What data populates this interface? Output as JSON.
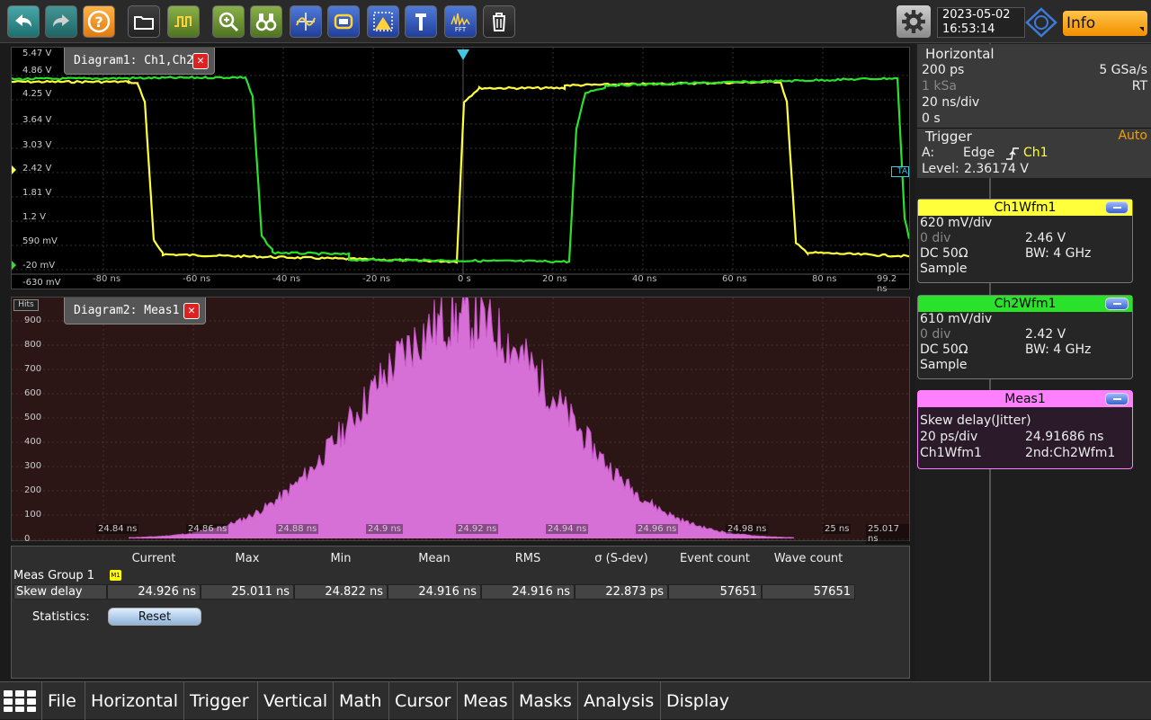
{
  "datetime": {
    "date": "2023-05-02",
    "time": "16:53:14"
  },
  "info_button": {
    "label": "Info"
  },
  "diagram1": {
    "title": "Diagram1: Ch1,Ch2",
    "y_labels": [
      "5.47 V",
      "4.86 V",
      "4.25 V",
      "3.64 V",
      "3.03 V",
      "2.42 V",
      "1.81 V",
      "1.2 V",
      "590 mV",
      "-20 mV",
      "-630 mV"
    ],
    "x_labels": [
      "-80 ns",
      "-60 ns",
      "-40 ns",
      "-20 ns",
      "0 s",
      "20 ns",
      "40 ns",
      "60 ns",
      "80 ns",
      "99.2 ns"
    ],
    "trigger_marker": "TA"
  },
  "diagram2": {
    "title": "Diagram2: Meas1",
    "corner_label": "Hits",
    "y_labels": [
      "900",
      "800",
      "700",
      "600",
      "500",
      "400",
      "300",
      "200",
      "100",
      "0"
    ],
    "x_labels": [
      "24.84 ns",
      "24.86 ns",
      "24.88 ns",
      "24.9 ns",
      "24.92 ns",
      "24.94 ns",
      "24.96 ns",
      "24.98 ns",
      "25 ns",
      "25.017 ns"
    ]
  },
  "meas_table": {
    "headers": [
      "Current",
      "Max",
      "Min",
      "Mean",
      "RMS",
      "σ (S-dev)",
      "Event count",
      "Wave count"
    ],
    "group_label": "Meas Group 1",
    "group_badge": "M1",
    "row_label": "Skew delay",
    "row_values": [
      "24.926 ns",
      "25.011 ns",
      "24.822 ns",
      "24.916 ns",
      "24.916 ns",
      "22.873 ps",
      "57651",
      "57651"
    ],
    "statistics_label": "Statistics:",
    "reset_label": "Reset"
  },
  "horizontal": {
    "title": "Horizontal",
    "resolution": "200 ps",
    "sample_rate": "5 GSa/s",
    "record_length": "1 kSa",
    "mode": "RT",
    "time_scale": "20 ns/div",
    "position": "0 s"
  },
  "trigger": {
    "title": "Trigger",
    "mode": "Auto",
    "source_prefix": "A:",
    "type": "Edge",
    "source": "Ch1",
    "level_label": "Level:",
    "level_value": "2.36174 V"
  },
  "ch1": {
    "title": "Ch1Wfm1",
    "scale": "620 mV/div",
    "offset": "0 div",
    "position": "2.46 V",
    "coupling": "DC 50Ω",
    "bandwidth": "BW: 4 GHz",
    "acq": "Sample"
  },
  "ch2": {
    "title": "Ch2Wfm1",
    "scale": "610 mV/div",
    "offset": "0 div",
    "position": "2.42 V",
    "coupling": "DC 50Ω",
    "bandwidth": "BW: 4 GHz",
    "acq": "Sample"
  },
  "meas1": {
    "title": "Meas1",
    "type": "Skew delay(Jitter)",
    "scale": "20 ps/div",
    "value": "24.91686 ns",
    "source1": "Ch1Wfm1",
    "source2": "2nd:Ch2Wfm1"
  },
  "menu": [
    "File",
    "Horizontal",
    "Trigger",
    "Vertical",
    "Math",
    "Cursor",
    "Meas",
    "Masks",
    "Analysis",
    "Display"
  ],
  "colors": {
    "ch1": "#ffff3c",
    "ch2": "#2be22b",
    "meas1": "#ff80ff",
    "histogram": "#e07ee0",
    "accent": "#f39000"
  }
}
